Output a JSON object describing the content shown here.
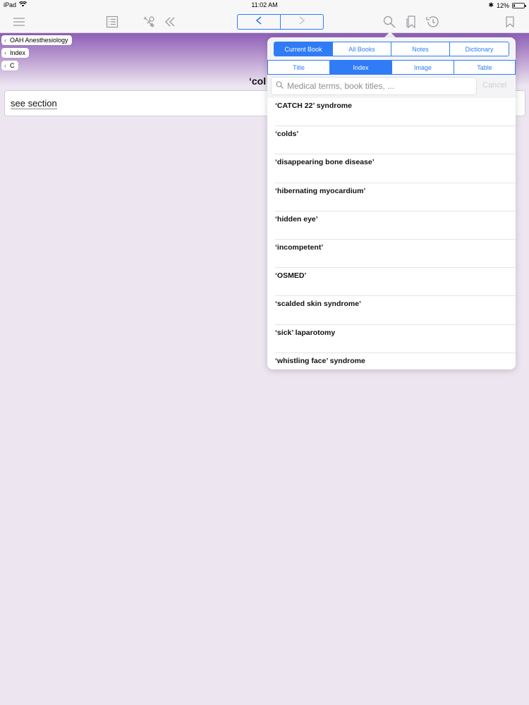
{
  "status_bar": {
    "device": "iPad",
    "time": "11:02 AM",
    "battery": "12%",
    "battery_level": 0.12
  },
  "toolbar": {
    "icons": [
      "menu-icon",
      "list-icon",
      "tools-icon",
      "double-chevron-left-icon",
      "back-icon",
      "forward-icon",
      "search-icon",
      "bookmarks-icon",
      "history-icon",
      "bookmark-icon"
    ]
  },
  "breadcrumbs": [
    {
      "label": "OAH Anesthesiology"
    },
    {
      "label": "Index"
    },
    {
      "label": "C"
    }
  ],
  "page": {
    "title": "‘col",
    "link": "see section"
  },
  "popover": {
    "scope_tabs": [
      {
        "label": "Current Book",
        "active": true
      },
      {
        "label": "All Books",
        "active": false
      },
      {
        "label": "Notes",
        "active": false
      },
      {
        "label": "Dictionary",
        "active": false
      }
    ],
    "type_tabs": [
      {
        "label": "Title",
        "active": false
      },
      {
        "label": "Index",
        "active": true
      },
      {
        "label": "Image",
        "active": false
      },
      {
        "label": "Table",
        "active": false
      }
    ],
    "search": {
      "placeholder": "Medical terms, book titles, ...",
      "value": ""
    },
    "cancel_label": "Cancel",
    "results": [
      "‘CATCH 22’ syndrome",
      "‘colds’",
      "‘disappearing bone disease’",
      "‘hibernating myocardium’",
      "‘hidden eye’",
      "‘incompetent’",
      "‘OSMED’",
      "‘scalded skin syndrome’",
      "‘sick’ laparotomy",
      "‘whistling face’ syndrome"
    ]
  },
  "colors": {
    "accent": "#2f7cf6",
    "header_purple": "#8e5fb6",
    "background": "#ede6f1"
  }
}
